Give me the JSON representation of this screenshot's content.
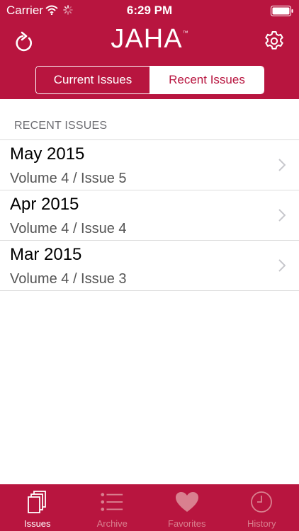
{
  "status_bar": {
    "carrier": "Carrier",
    "time": "6:29 PM"
  },
  "nav": {
    "title": "JAHA",
    "trademark": "™",
    "left_icon": "refresh-icon",
    "right_icon": "gear-icon"
  },
  "segments": {
    "current": "Current Issues",
    "recent": "Recent Issues",
    "selected": "recent"
  },
  "section": {
    "header": "RECENT ISSUES"
  },
  "issues": [
    {
      "title": "May 2015",
      "subtitle": "Volume 4 / Issue 5"
    },
    {
      "title": "Apr 2015",
      "subtitle": "Volume 4 / Issue 4"
    },
    {
      "title": "Mar 2015",
      "subtitle": "Volume 4 / Issue 3"
    }
  ],
  "tabs": [
    {
      "label": "Issues",
      "icon": "issues-icon",
      "active": true
    },
    {
      "label": "Archive",
      "icon": "archive-list-icon",
      "active": false
    },
    {
      "label": "Favorites",
      "icon": "heart-icon",
      "active": false
    },
    {
      "label": "History",
      "icon": "clock-icon",
      "active": false
    }
  ],
  "colors": {
    "brand": "#b8153f",
    "inactive_tab": "#d9808f",
    "chevron": "#c7c7cc"
  }
}
